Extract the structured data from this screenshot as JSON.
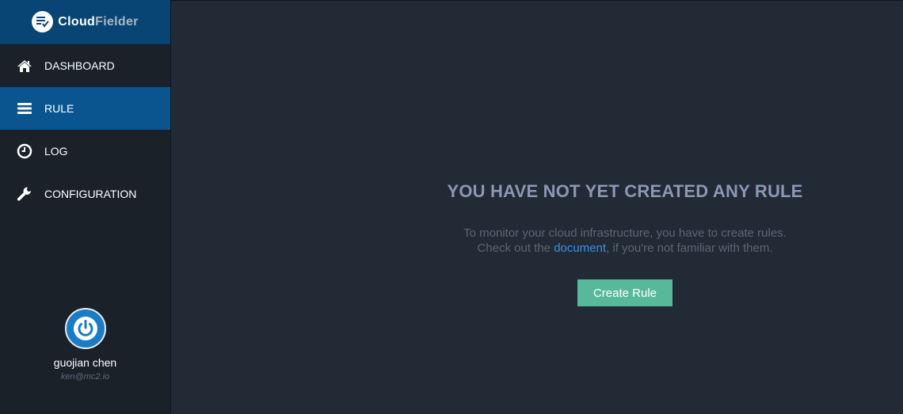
{
  "brand": {
    "part1": "Cloud",
    "part2": "Fielder"
  },
  "nav": [
    {
      "label": "DASHBOARD",
      "icon": "home-icon",
      "active": false
    },
    {
      "label": "RULE",
      "icon": "list-icon",
      "active": true
    },
    {
      "label": "LOG",
      "icon": "clock-icon",
      "active": false
    },
    {
      "label": "CONFIGURATION",
      "icon": "wrench-icon",
      "active": false
    }
  ],
  "user": {
    "name": "guojian chen",
    "email": "ken@mc2.io",
    "avatar_icon": "power-icon"
  },
  "empty_state": {
    "title": "YOU HAVE NOT YET CREATED ANY RULE",
    "line1": "To monitor your cloud infrastructure, you have to create rules.",
    "line2_pre": "Check out the ",
    "link": "document",
    "line2_post": ", if you're not familiar with them.",
    "button": "Create Rule"
  },
  "colors": {
    "sidebar_bg": "#1b2129",
    "brand_bg": "#084474",
    "active_bg": "#0a5590",
    "main_bg": "#222a35",
    "button_bg": "#58b99a",
    "link": "#3d8fe0"
  }
}
